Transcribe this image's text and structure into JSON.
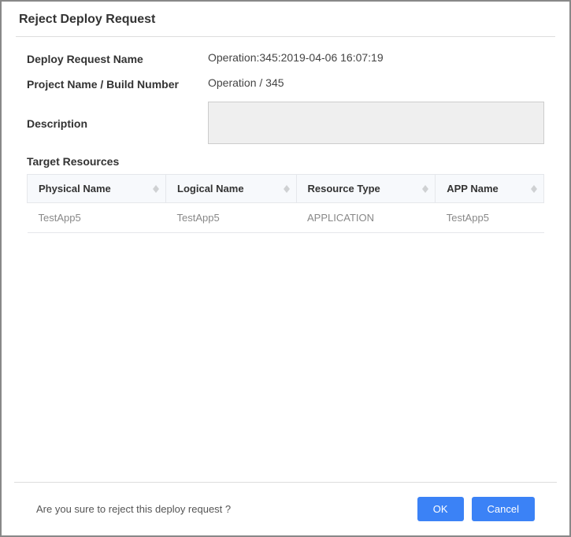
{
  "header": {
    "title": "Reject Deploy Request"
  },
  "form": {
    "deploy_request_name_label": "Deploy Request Name",
    "deploy_request_name_value": "Operation:345:2019-04-06 16:07:19",
    "project_label": "Project Name / Build Number",
    "project_value": "Operation / 345",
    "description_label": "Description"
  },
  "table": {
    "section_title": "Target Resources",
    "columns": {
      "physical_name": "Physical  Name",
      "logical_name": "Logical  Name",
      "resource_type": "Resource  Type",
      "app_name": "APP  Name"
    },
    "rows": [
      {
        "physical_name": "TestApp5",
        "logical_name": "TestApp5",
        "resource_type": "APPLICATION",
        "app_name": "TestApp5"
      }
    ]
  },
  "footer": {
    "confirm_text": "Are you sure to reject this deploy request ?",
    "ok_label": "OK",
    "cancel_label": "Cancel"
  }
}
